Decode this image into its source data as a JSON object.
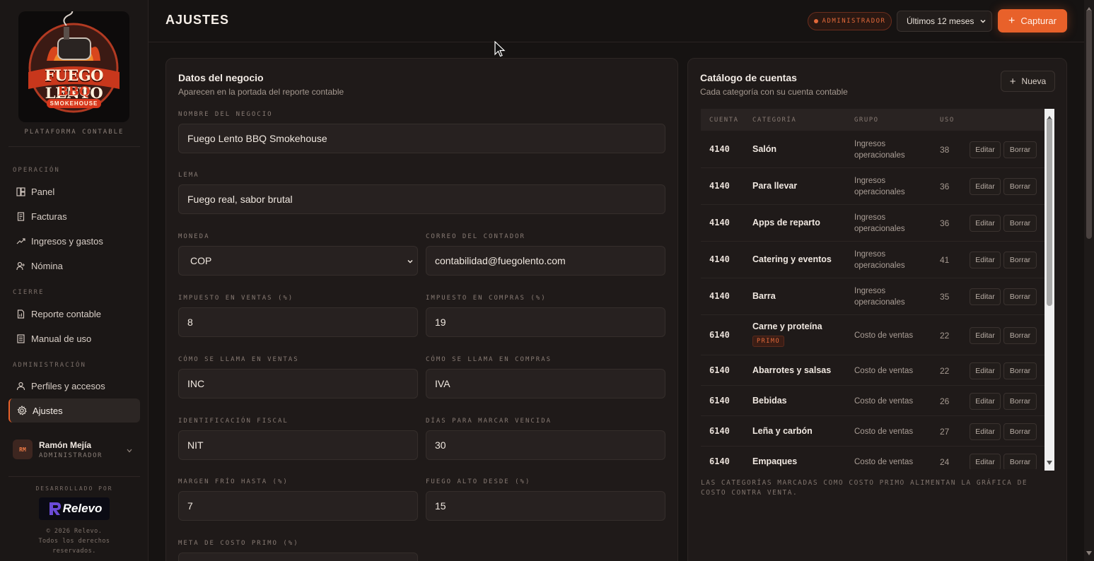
{
  "brand": {
    "logo_line1": "FUEGO LENTO",
    "logo_line2": "BBQ",
    "logo_line3": "SMOKEHOUSE",
    "platform_label": "PLATAFORMA CONTABLE"
  },
  "sidebar": {
    "sections": [
      {
        "title": "OPERACIÓN",
        "items": [
          {
            "label": "Panel",
            "icon": "dashboard-icon"
          },
          {
            "label": "Facturas",
            "icon": "invoice-icon"
          },
          {
            "label": "Ingresos y gastos",
            "icon": "trend-icon"
          },
          {
            "label": "Nómina",
            "icon": "user-plus-icon"
          }
        ]
      },
      {
        "title": "CIERRE",
        "items": [
          {
            "label": "Reporte contable",
            "icon": "report-icon"
          },
          {
            "label": "Manual de uso",
            "icon": "manual-icon"
          }
        ]
      },
      {
        "title": "ADMINISTRACIÓN",
        "items": [
          {
            "label": "Perfiles y accesos",
            "icon": "user-icon"
          },
          {
            "label": "Ajustes",
            "icon": "gear-icon",
            "active": true
          }
        ]
      }
    ],
    "user": {
      "initials": "RM",
      "name": "Ramón Mejía",
      "role": "ADMINISTRADOR"
    },
    "footer": {
      "developed_by": "DESARROLLADO POR",
      "dev_logo": "Relevo",
      "copyright": "© 2026 Relevo.",
      "rights_line1": "Todos los derechos",
      "rights_line2": "reservados."
    }
  },
  "header": {
    "title": "AJUSTES",
    "role_badge": "ADMINISTRADOR",
    "period": "Últimos 12 meses",
    "capture_label": "Capturar",
    "accent": "#e8612a"
  },
  "business": {
    "title": "Datos del negocio",
    "subtitle": "Aparecen en la portada del reporte contable",
    "fields": {
      "name": {
        "label": "NOMBRE DEL NEGOCIO",
        "value": "Fuego Lento BBQ Smokehouse"
      },
      "slogan": {
        "label": "LEMA",
        "value": "Fuego real, sabor brutal"
      },
      "currency": {
        "label": "MONEDA",
        "value": "COP"
      },
      "accountant_email": {
        "label": "CORREO DEL CONTADOR",
        "value": "contabilidad@fuegolento.com"
      },
      "sales_tax": {
        "label": "IMPUESTO EN VENTAS (%)",
        "value": "8"
      },
      "purchase_tax": {
        "label": "IMPUESTO EN COMPRAS (%)",
        "value": "19"
      },
      "sales_tax_name": {
        "label": "CÓMO SE LLAMA EN VENTAS",
        "value": "INC"
      },
      "purchase_tax_name": {
        "label": "CÓMO SE LLAMA EN COMPRAS",
        "value": "IVA"
      },
      "tax_id": {
        "label": "IDENTIFICACIÓN FISCAL",
        "value": "NIT"
      },
      "overdue_days": {
        "label": "DÍAS PARA MARCAR VENCIDA",
        "value": "30"
      },
      "cold_margin": {
        "label": "MARGEN FRÍO HASTA (%)",
        "value": "7"
      },
      "hot_from": {
        "label": "FUEGO ALTO DESDE (%)",
        "value": "15"
      },
      "prime_cost_goal": {
        "label": "META DE COSTO PRIMO (%)"
      }
    }
  },
  "catalog": {
    "title": "Catálogo de cuentas",
    "subtitle": "Cada categoría con su cuenta contable",
    "new_label": "Nueva",
    "columns": [
      "CUENTA",
      "CATEGORÍA",
      "GRUPO",
      "USO"
    ],
    "edit_label": "Editar",
    "delete_label": "Borrar",
    "primo_label": "PRIMO",
    "rows": [
      {
        "code": "4140",
        "category": "Salón",
        "group_line1": "Ingresos",
        "group_line2": "operacionales",
        "uso": "38"
      },
      {
        "code": "4140",
        "category": "Para llevar",
        "group_line1": "Ingresos",
        "group_line2": "operacionales",
        "uso": "36"
      },
      {
        "code": "4140",
        "category": "Apps de reparto",
        "group_line1": "Ingresos",
        "group_line2": "operacionales",
        "uso": "36"
      },
      {
        "code": "4140",
        "category": "Catering y eventos",
        "group_line1": "Ingresos",
        "group_line2": "operacionales",
        "uso": "41"
      },
      {
        "code": "4140",
        "category": "Barra",
        "group_line1": "Ingresos",
        "group_line2": "operacionales",
        "uso": "35"
      },
      {
        "code": "6140",
        "category": "Carne y proteína",
        "group_line1": "Costo de ventas",
        "group_line2": "",
        "uso": "22",
        "primo": true
      },
      {
        "code": "6140",
        "category": "Abarrotes y salsas",
        "group_line1": "Costo de ventas",
        "group_line2": "",
        "uso": "22"
      },
      {
        "code": "6140",
        "category": "Bebidas",
        "group_line1": "Costo de ventas",
        "group_line2": "",
        "uso": "26"
      },
      {
        "code": "6140",
        "category": "Leña y carbón",
        "group_line1": "Costo de ventas",
        "group_line2": "",
        "uso": "27"
      },
      {
        "code": "6140",
        "category": "Empaques",
        "group_line1": "Costo de ventas",
        "group_line2": "",
        "uso": "24"
      }
    ],
    "note": "LAS CATEGORÍAS MARCADAS COMO COSTO PRIMO ALIMENTAN LA GRÁFICA DE COSTO CONTRA VENTA."
  }
}
